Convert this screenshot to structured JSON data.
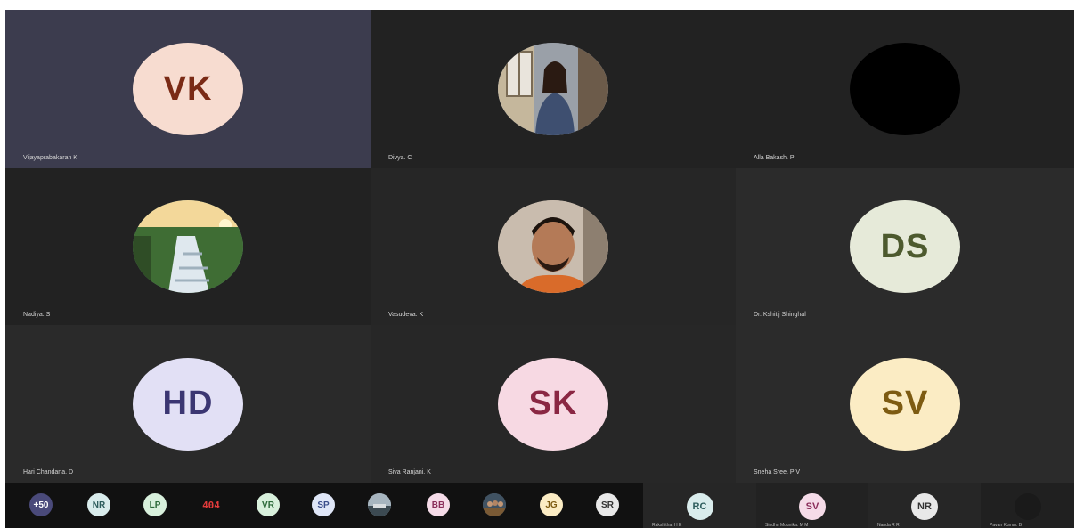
{
  "tiles": [
    {
      "name": "Vijayaprabakaran K",
      "initials": "VK",
      "bg": "#3c3c4e",
      "avatar_bg": "#f7dcd0",
      "avatar_fg": "#7a2a15",
      "kind": "initials"
    },
    {
      "name": "Divya. C",
      "initials": "",
      "bg": "#222222",
      "avatar_bg": "#8a8f9a",
      "avatar_fg": "#000000",
      "kind": "photo-person-girl"
    },
    {
      "name": "Alla Bakash. P",
      "initials": "",
      "bg": "#222222",
      "avatar_bg": "#000000",
      "avatar_fg": "#000000",
      "kind": "blank"
    },
    {
      "name": "Nadiya. S",
      "initials": "",
      "bg": "#222222",
      "avatar_bg": "#3d6a33",
      "avatar_fg": "#000000",
      "kind": "photo-waterfall"
    },
    {
      "name": "Vasudeva. K",
      "initials": "",
      "bg": "#262626",
      "avatar_bg": "#c8b8a5",
      "avatar_fg": "#000000",
      "kind": "photo-person-boy"
    },
    {
      "name": "Dr. Kshitij Shinghal",
      "initials": "DS",
      "bg": "#2b2b2b",
      "avatar_bg": "#e6ead9",
      "avatar_fg": "#4d5a2e",
      "kind": "initials"
    },
    {
      "name": "Hari Chandana. D",
      "initials": "HD",
      "bg": "#2a2a2a",
      "avatar_bg": "#e2e0f5",
      "avatar_fg": "#3b3672",
      "kind": "initials"
    },
    {
      "name": "Siva Ranjani. K",
      "initials": "SK",
      "bg": "#272727",
      "avatar_bg": "#f7d9e3",
      "avatar_fg": "#8a2743",
      "kind": "initials"
    },
    {
      "name": "Sneha Sree. P V",
      "initials": "SV",
      "bg": "#2b2b2b",
      "avatar_bg": "#fbecc4",
      "avatar_fg": "#7d5b12",
      "kind": "initials"
    }
  ],
  "strip": {
    "chips": [
      {
        "label": "+50",
        "bg": "#4a4a7a",
        "fg": "#ffffff",
        "kind": "text"
      },
      {
        "label": "NR",
        "bg": "#d9ecec",
        "fg": "#2d5c5c",
        "kind": "text"
      },
      {
        "label": "LP",
        "bg": "#d8f0dc",
        "fg": "#2d6a3a",
        "kind": "text"
      },
      {
        "label": "404",
        "bg": "#111111",
        "fg": "#e23b3b",
        "kind": "error-404"
      },
      {
        "label": "VR",
        "bg": "#d8f0dc",
        "fg": "#2d6a3a",
        "kind": "text"
      },
      {
        "label": "SP",
        "bg": "#dfe6f7",
        "fg": "#3a4d8a",
        "kind": "text"
      },
      {
        "label": "",
        "bg": "#7f8b96",
        "fg": "#000000",
        "kind": "photo-landscape"
      },
      {
        "label": "BB",
        "bg": "#f5dbe8",
        "fg": "#8a2d5a",
        "kind": "text"
      },
      {
        "label": "",
        "bg": "#5b6a79",
        "fg": "#000000",
        "kind": "photo-group"
      },
      {
        "label": "JG",
        "bg": "#fbecc4",
        "fg": "#7d5b12",
        "kind": "text"
      },
      {
        "label": "SR",
        "bg": "#e8e8e8",
        "fg": "#333333",
        "kind": "text"
      }
    ],
    "panels": [
      {
        "label": "RC",
        "name": "Rakshitha. H E",
        "bg": "#262626",
        "chip_bg": "#d9ecec",
        "chip_fg": "#2d5c5c"
      },
      {
        "label": "SV",
        "name": "Sindhu Mounika. M M",
        "bg": "#222222",
        "chip_bg": "#f5dbe8",
        "chip_fg": "#8a2d5a"
      },
      {
        "label": "NR",
        "name": "Nanda R R",
        "bg": "#262626",
        "chip_bg": "#e8e8e8",
        "chip_fg": "#333333"
      },
      {
        "label": "",
        "name": "Pavan Kumar. B",
        "bg": "#202020",
        "chip_bg": "#1a1a1a",
        "chip_fg": "#000000"
      }
    ]
  }
}
